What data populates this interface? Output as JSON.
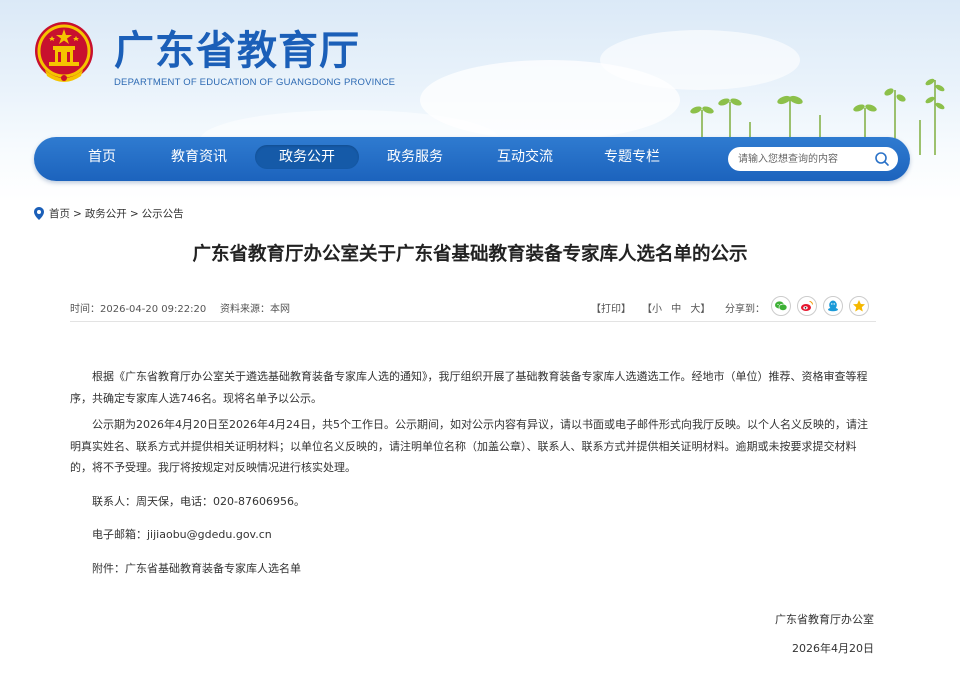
{
  "header": {
    "title": "广东省教育厅",
    "subtitle": "DEPARTMENT OF EDUCATION OF GUANGDONG PROVINCE"
  },
  "nav": {
    "items": [
      {
        "label": "首页"
      },
      {
        "label": "教育资讯"
      },
      {
        "label": "政务公开"
      },
      {
        "label": "政务服务"
      },
      {
        "label": "互动交流"
      },
      {
        "label": "专题专栏"
      }
    ],
    "active_index": 2,
    "search_placeholder": "请输入您想查询的内容"
  },
  "breadcrumb": {
    "items": [
      "首页",
      "政务公开",
      "公示公告"
    ],
    "separator": ">"
  },
  "article": {
    "title": "广东省教育厅办公室关于广东省基础教育装备专家库人选名单的公示",
    "time": "时间：2026-04-20 09:22:20",
    "source": "资料来源：本网",
    "print": "【打印】",
    "fontsize_prefix": "【",
    "fontsize_options": [
      "小",
      "中",
      "大"
    ],
    "fontsize_suffix": "】",
    "share_label": "分享到：",
    "paragraphs": [
      "根据《广东省教育厅办公室关于遴选基础教育装备专家库人选的通知》，我厅组织开展了基础教育装备专家库人选遴选工作。经地市（单位）推荐、资格审查等程序，共确定专家库人选746名。现将名单予以公示。",
      "公示期为2026年4月20日至2026年4月24日，共5个工作日。公示期间，如对公示内容有异议，请以书面或电子邮件形式向我厅反映。以个人名义反映的，请注明真实姓名、联系方式并提供相关证明材料；以单位名义反映的，请注明单位名称（加盖公章）、联系人、联系方式并提供相关证明材料。逾期或未按要求提交材料的，将不予受理。我厅将按规定对反映情况进行核实处理。"
    ],
    "contact": "联系人：周天保，电话：020-87606956。",
    "email": "电子邮箱：jijiaobu@gdedu.gov.cn",
    "attachment_label": "附件：",
    "attachment_link": "广东省基础教育装备专家库人选名单",
    "sign_org": "广东省教育厅办公室",
    "sign_date": "2026年4月20日"
  },
  "colors": {
    "brand_blue": "#1b5fb8",
    "nav_blue": "#2a72c8",
    "nav_active": "#155aa8"
  },
  "icons": [
    "national-emblem-icon",
    "search-icon",
    "location-pin-icon",
    "wechat-icon",
    "weibo-icon",
    "qq-icon",
    "qzone-icon"
  ]
}
